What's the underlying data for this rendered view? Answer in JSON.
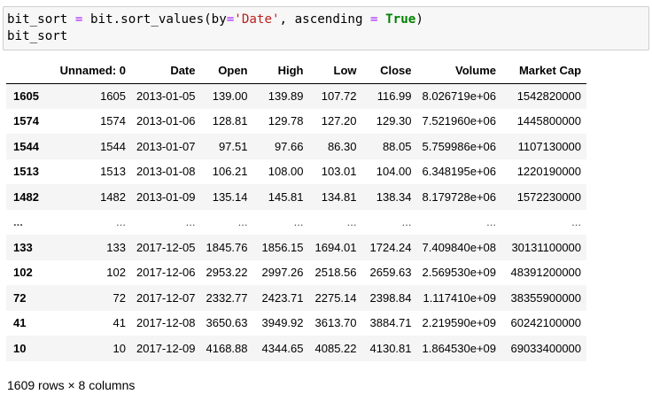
{
  "code": {
    "line1": {
      "var": "bit_sort",
      "eq": "=",
      "call": "bit.sort_values(by",
      "eq2": "=",
      "str": "'Date'",
      "mid": ", ascending",
      "eq3": "=",
      "kw": "True",
      "close": ")"
    },
    "line2": "bit_sort"
  },
  "table": {
    "columns": [
      "",
      "Unnamed: 0",
      "Date",
      "Open",
      "High",
      "Low",
      "Close",
      "Volume",
      "Market Cap"
    ],
    "rows": [
      [
        "1605",
        "1605",
        "2013-01-05",
        "139.00",
        "139.89",
        "107.72",
        "116.99",
        "8.026719e+06",
        "1542820000"
      ],
      [
        "1574",
        "1574",
        "2013-01-06",
        "128.81",
        "129.78",
        "127.20",
        "129.30",
        "7.521960e+06",
        "1445800000"
      ],
      [
        "1544",
        "1544",
        "2013-01-07",
        "97.51",
        "97.66",
        "86.30",
        "88.05",
        "5.759986e+06",
        "1107130000"
      ],
      [
        "1513",
        "1513",
        "2013-01-08",
        "106.21",
        "108.00",
        "103.01",
        "104.00",
        "6.348195e+06",
        "1220190000"
      ],
      [
        "1482",
        "1482",
        "2013-01-09",
        "135.14",
        "145.81",
        "134.81",
        "138.34",
        "8.179728e+06",
        "1572230000"
      ],
      [
        "...",
        "...",
        "...",
        "...",
        "...",
        "...",
        "...",
        "...",
        "..."
      ],
      [
        "133",
        "133",
        "2017-12-05",
        "1845.76",
        "1856.15",
        "1694.01",
        "1724.24",
        "7.409840e+08",
        "30131100000"
      ],
      [
        "102",
        "102",
        "2017-12-06",
        "2953.22",
        "2997.26",
        "2518.56",
        "2659.63",
        "2.569530e+09",
        "48391200000"
      ],
      [
        "72",
        "72",
        "2017-12-07",
        "2332.77",
        "2423.71",
        "2275.14",
        "2398.84",
        "1.117410e+09",
        "38355900000"
      ],
      [
        "41",
        "41",
        "2017-12-08",
        "3650.63",
        "3949.92",
        "3613.70",
        "3884.71",
        "2.219590e+09",
        "60242100000"
      ],
      [
        "10",
        "10",
        "2017-12-09",
        "4168.88",
        "4344.65",
        "4085.22",
        "4130.81",
        "1.864530e+09",
        "69033400000"
      ]
    ]
  },
  "footer": "1609 rows × 8 columns"
}
